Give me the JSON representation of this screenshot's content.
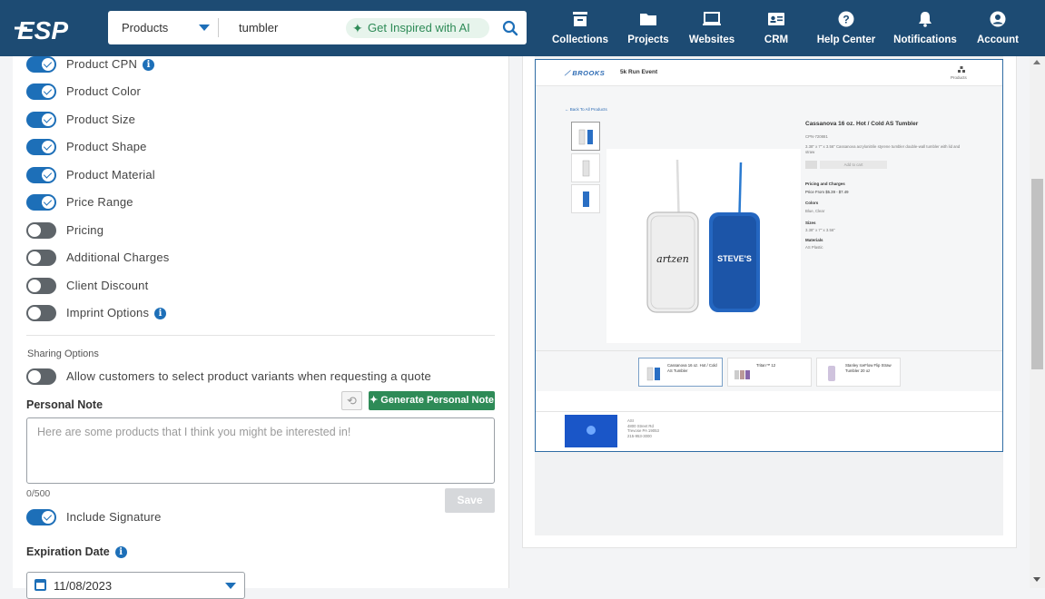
{
  "app": {
    "logo_text": "ESP"
  },
  "search": {
    "category": "Products",
    "query": "tumbler",
    "inspire_label": "Get Inspired with AI"
  },
  "nav": [
    {
      "label": "Collections",
      "icon": "collections-icon"
    },
    {
      "label": "Projects",
      "icon": "folder-icon"
    },
    {
      "label": "Websites",
      "icon": "monitor-icon"
    },
    {
      "label": "CRM",
      "icon": "contact-card-icon"
    },
    {
      "label": "Help Center",
      "icon": "help-icon"
    },
    {
      "label": "Notifications",
      "icon": "bell-icon"
    },
    {
      "label": "Account",
      "icon": "account-icon"
    }
  ],
  "options": [
    {
      "label": "Product CPN",
      "on": true,
      "info": true
    },
    {
      "label": "Product Color",
      "on": true
    },
    {
      "label": "Product Size",
      "on": true
    },
    {
      "label": "Product Shape",
      "on": true
    },
    {
      "label": "Product Material",
      "on": true
    },
    {
      "label": "Price Range",
      "on": true
    },
    {
      "label": "Pricing",
      "on": false
    },
    {
      "label": "Additional Charges",
      "on": false
    },
    {
      "label": "Client Discount",
      "on": false
    },
    {
      "label": "Imprint Options",
      "on": false,
      "info": true
    }
  ],
  "sharing": {
    "section_label": "Sharing Options",
    "variants_label": "Allow customers to select product variants when requesting a quote",
    "variants_on": false
  },
  "personal_note": {
    "label": "Personal Note",
    "generate_label": "Generate Personal Note",
    "placeholder": "Here are some products that I think you might be interested in!",
    "count": "0/500",
    "save_label": "Save"
  },
  "signature": {
    "label": "Include Signature",
    "on": true
  },
  "expiration": {
    "label": "Expiration Date",
    "value": "11/08/2023"
  },
  "preview": {
    "brand": "BROOKS",
    "event": "5k Run Event",
    "products_link": "Products",
    "back_link": "← Back To All Products",
    "product_title": "Cassanova 16 oz. Hot / Cold AS Tumbler",
    "cpn": "CPN-720881",
    "description": "3.38\" x 7\" x 3.56\" Cassanova acrylonitrile styrene tumbler double-wall tumbler with lid and straw",
    "add_label": "Add to cart",
    "pricing_heading": "Pricing and Charges",
    "price_range": "Price From $5.39 - $7.49",
    "colors_heading": "Colors",
    "colors_value": "Blue, Clear",
    "sizes_heading": "Sizes",
    "sizes_value": "3.38\" x 7\" x 3.56\"",
    "materials_heading": "Materials",
    "materials_value": "AS Plastic",
    "related": [
      "Cassanova 16 oz. Hot / Cold AS Tumbler",
      "Tritan™ 12",
      "Stanley IceFlow Flip Straw Tumbler 20 oz"
    ],
    "footer_company": "ASI",
    "footer_street": "4800 Street Rd",
    "footer_city": "Trevose PA 19053",
    "footer_phone": "215-953-3000"
  }
}
